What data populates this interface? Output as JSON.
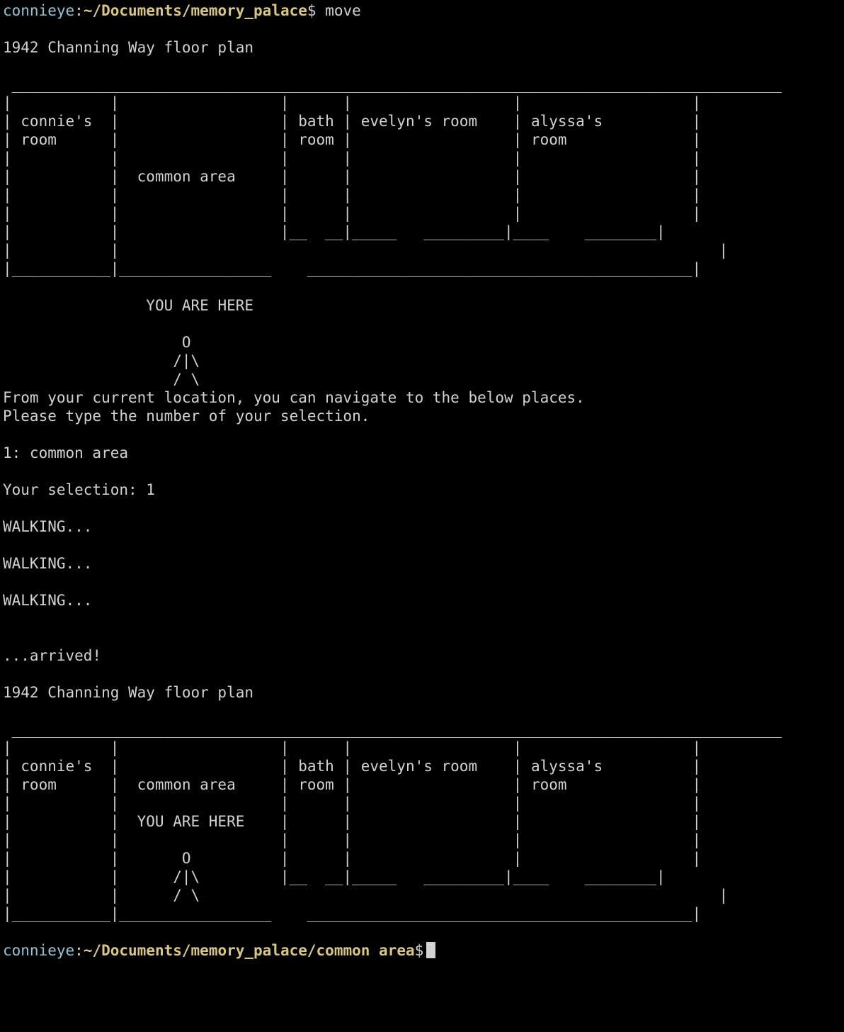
{
  "colors": {
    "background": "#000000",
    "foreground": "#d2d2d2",
    "prompt_user": "#93c5d4",
    "prompt_path": "#d8c780"
  },
  "prompt1": {
    "user": "connieye",
    "path": "~/Documents/memory_palace",
    "symbol": "$",
    "command": "move"
  },
  "plan1": {
    "title": "1942 Channing Way floor plan",
    "rows": [
      " ______________________________________________________________________________________",
      "|           |                  |      |                  |                   |",
      "| connie's  |                  | bath | evelyn's room    | alyssa's          |",
      "| room      |                  | room |                  | room              |",
      "|           |                  |      |                  |                   |",
      "|           |  common area     |      |                  |                   |",
      "|           |                  |      |                  |                   |",
      "|           |                  |      |                  |                   |",
      "|           |                  |__  __|_____   _________|____    ________|",
      "|           |                                                                   |",
      "|___________|_________________    ___________________________________________|"
    ],
    "here_label": "YOU ARE HERE",
    "figure": [
      "O",
      "/|\\",
      "/ \\"
    ]
  },
  "nav": {
    "intro1": "From your current location, you can navigate to the below places.",
    "intro2": "Please type the number of your selection.",
    "option": "1: common area",
    "selection": "Your selection: 1",
    "walking": [
      "WALKING...",
      "WALKING...",
      "WALKING..."
    ],
    "arrived": "...arrived!"
  },
  "plan2": {
    "title": "1942 Channing Way floor plan",
    "rows": [
      " ______________________________________________________________________________________",
      "|           |                  |      |                  |                   |",
      "| connie's  |                  | bath | evelyn's room    | alyssa's          |",
      "| room      |  common area     | room |                  | room              |",
      "|           |                  |      |                  |                   |",
      "|           |  YOU ARE HERE    |      |                  |                   |",
      "|           |                  |      |                  |                   |",
      "|           |       O          |      |                  |                   |",
      "|           |      /|\\         |__  __|_____   _________|____    ________|",
      "|           |      / \\                                                          |",
      "|___________|_________________    ___________________________________________|"
    ]
  },
  "prompt2": {
    "user": "connieye",
    "path": "~/Documents/memory_palace/common area",
    "symbol": "$"
  }
}
